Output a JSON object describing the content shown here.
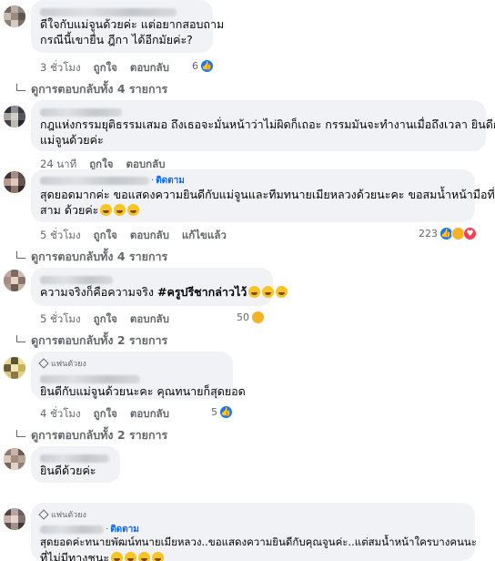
{
  "comments": [
    {
      "lines": [
        "ดีใจกับแม่จูนด้วยค่ะ แต่อยากสอบถาม",
        "กรณีนี้เขายื่น ฎีกา ได้อีกมัยค่ะ?"
      ],
      "time": "3 ชั่วโมง",
      "like": "ถูกใจ",
      "reply": "ตอบกลับ",
      "react_count": "6",
      "replies_text": "ดูการตอบกลับทั้ง 4 รายการ"
    },
    {
      "lines": [
        "กฎแห่งกรรมยุติธรรมเสมอ ถึงเธอจะมั่นหน้าว่าไม่ผิดก็เถอะ กรรมมันจะทำงานเมื่อถึงเวลา ยินดีกับ",
        "แม่จูนด้วยค่ะ"
      ],
      "time": "24 นาที",
      "like": "ถูกใจ",
      "reply": "ตอบกลับ"
    },
    {
      "follow": "ติดตาม",
      "lines": [
        "สุดยอดมากค่ะ ขอแสดงความยินดีกับแม่จูนและทีมทนายเมียหลวงด้วยนะคะ ขอสมน้ำหน้ามือที่",
        "สาม ด้วยค่ะ"
      ],
      "time": "5 ชั่วโมง",
      "like": "ถูกใจ",
      "reply": "ตอบกลับ",
      "translate": "แก้ไขแล้ว",
      "react_count": "223",
      "replies_text": "ดูการตอบกลับทั้ง 4 รายการ"
    },
    {
      "lines": [
        "ความจริงก็คือความจริง "
      ],
      "bold": "#ครูปรีชากล่าวไว้",
      "time": "5 ชั่วโมง",
      "like": "ถูกใจ",
      "reply": "ตอบกลับ",
      "react_count": "50",
      "replies_text": "ดูการตอบกลับทั้ง 2 รายการ"
    },
    {
      "badge": "แฟนตัวยง",
      "lines": [
        "ยินดีกับแม่จูนด้วยนะคะ คุณทนายก็สุดยอด"
      ],
      "time": "4 ชั่วโมง",
      "like": "ถูกใจ",
      "reply": "ตอบกลับ",
      "react_count": "5",
      "replies_text": "ดูการตอบกลับทั้ง 2 รายการ"
    },
    {
      "lines": [
        "ยินดีด้วยค่ะ"
      ]
    },
    {
      "badge": "แฟนตัวยง",
      "follow": "ติดตาม",
      "lines": [
        "สุดยอดค่ะทนายพัฒน์ทนายเมียหลวง..ขอแสดงความยินดีกับคุณจูนค่ะ..แต่สมน้ำหน้าใครบางคนนะ",
        "ที่ไม่มีทางชนะ"
      ]
    }
  ],
  "colors": {
    "link": "#0866ff",
    "bubble": "#f0f2f5",
    "meta": "#65676b"
  }
}
